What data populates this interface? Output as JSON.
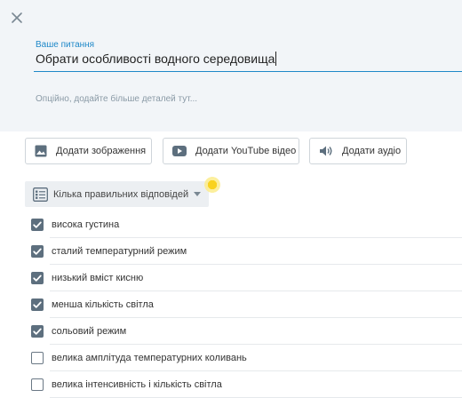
{
  "question": {
    "label": "Ваше питання",
    "value": "Обрати особливості водного середовища",
    "details_placeholder": "Опційно, додайте більше деталей тут..."
  },
  "media": {
    "image_label": "Додати зображення",
    "youtube_label": "Додати YouTube відео",
    "audio_label": "Додати аудіо"
  },
  "answers_type": {
    "label": "Кілька правильних відповідей"
  },
  "options": [
    {
      "text": "висока густина",
      "checked": true
    },
    {
      "text": "сталий температурний режим",
      "checked": true
    },
    {
      "text": "низький вміст кисню",
      "checked": true
    },
    {
      "text": "менша кількість світла",
      "checked": true
    },
    {
      "text": "сольовий режим",
      "checked": true
    },
    {
      "text": "велика амплітуда температурних коливань",
      "checked": false
    },
    {
      "text": "велика інтенсивність і кількість світла",
      "checked": false
    }
  ],
  "colors": {
    "accent": "#1e88c8",
    "panel": "#f2f5f8",
    "checkbox": "#5d6f7e",
    "hint": "#f9d21f"
  }
}
